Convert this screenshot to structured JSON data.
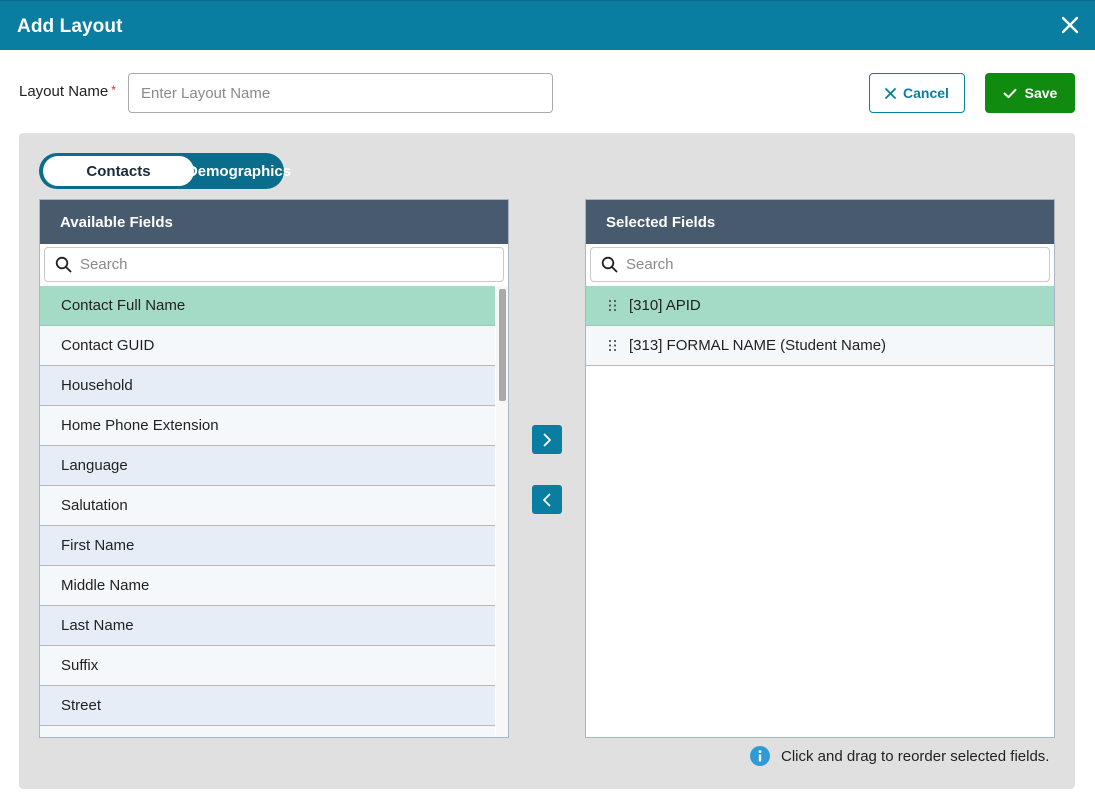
{
  "dialog": {
    "title": "Add Layout"
  },
  "form": {
    "layout_name_label": "Layout Name",
    "required_marker": "*",
    "layout_name_value": "",
    "layout_name_placeholder": "Enter Layout Name"
  },
  "actions": {
    "cancel_label": "Cancel",
    "save_label": "Save"
  },
  "tabs": {
    "active": "Contacts",
    "inactive": "Demographics"
  },
  "available": {
    "header": "Available Fields",
    "search_placeholder": "Search",
    "items": [
      "Contact Full Name",
      "Contact GUID",
      "Household",
      "Home Phone Extension",
      "Language",
      "Salutation",
      "First Name",
      "Middle Name",
      "Last Name",
      "Suffix",
      "Street",
      ""
    ],
    "selected_index": 0
  },
  "selected": {
    "header": "Selected Fields",
    "search_placeholder": "Search",
    "items": [
      "[310] APID",
      "[313] FORMAL NAME (Student Name)"
    ],
    "selected_index": 0
  },
  "hint": {
    "text": "Click and drag to reorder selected fields."
  },
  "colors": {
    "header_teal": "#0a7ea0",
    "save_green": "#118a10",
    "list_header": "#475a6e",
    "selected_row": "#a3dbc6",
    "info_blue": "#2f9bd6"
  }
}
